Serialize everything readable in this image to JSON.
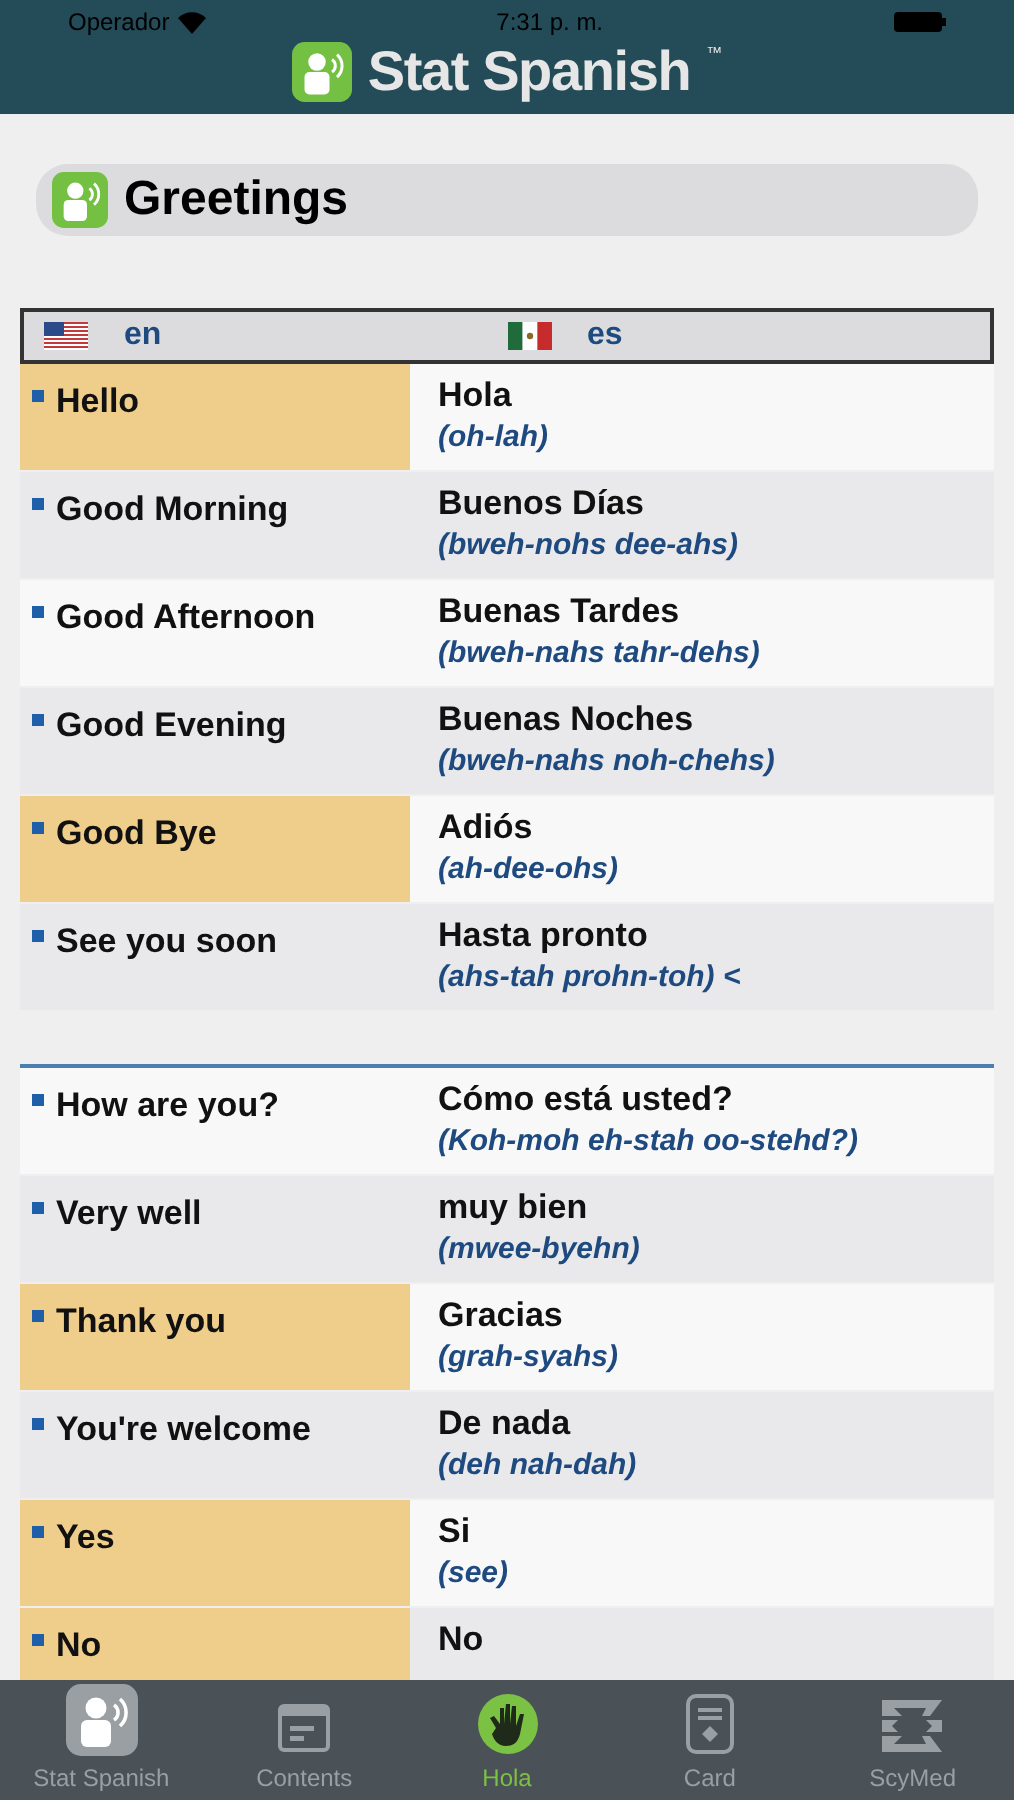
{
  "status_bar": {
    "carrier": "Operador",
    "time": "7:31 p. m."
  },
  "app_title": {
    "name": "Stat Spanish",
    "mark": "™"
  },
  "section_title": "Greetings",
  "table_header": {
    "left": "en",
    "right": "es"
  },
  "groups": [
    {
      "rows": [
        {
          "en": "Hello",
          "es": "Hola",
          "pron": "(oh-lah)",
          "highlighted": true
        },
        {
          "en": "Good Morning",
          "es": "Buenos Días",
          "pron": "(bweh-nohs dee-ahs)",
          "highlighted": false
        },
        {
          "en": "Good Afternoon",
          "es": "Buenas Tardes",
          "pron": "(bweh-nahs tahr-dehs)",
          "highlighted": false
        },
        {
          "en": "Good Evening",
          "es": "Buenas Noches",
          "pron": "(bweh-nahs noh-chehs)",
          "highlighted": false
        },
        {
          "en": "Good Bye",
          "es": "Adiós",
          "pron": "(ah-dee-ohs)",
          "highlighted": true
        },
        {
          "en": "See you soon",
          "es": "Hasta pronto",
          "pron": "(ahs-tah prohn-toh) <",
          "highlighted": false
        }
      ]
    },
    {
      "rows": [
        {
          "en": "How are you?",
          "es": "Cómo está usted?",
          "pron": "(Koh-moh eh-stah oo-stehd?)",
          "highlighted": false
        },
        {
          "en": "Very well",
          "es": "muy bien",
          "pron": "(mwee-byehn)",
          "highlighted": false
        },
        {
          "en": "Thank you",
          "es": "Gracias",
          "pron": "(grah-syahs)",
          "highlighted": true
        },
        {
          "en": "You're welcome",
          "es": "De nada",
          "pron": "(deh nah-dah)",
          "highlighted": false
        },
        {
          "en": "Yes",
          "es": "Si",
          "pron": "(see)",
          "highlighted": true
        },
        {
          "en": "No",
          "es": "No",
          "highlighted": true
        }
      ]
    }
  ],
  "tabs": [
    {
      "label": "Stat Spanish",
      "kind": "person",
      "selected": false
    },
    {
      "label": "Contents",
      "kind": "contents",
      "selected": false
    },
    {
      "label": "Hola",
      "kind": "hand",
      "selected": true
    },
    {
      "label": "Card",
      "kind": "card",
      "selected": false
    },
    {
      "label": "ScyMed",
      "kind": "logo",
      "selected": false
    }
  ]
}
